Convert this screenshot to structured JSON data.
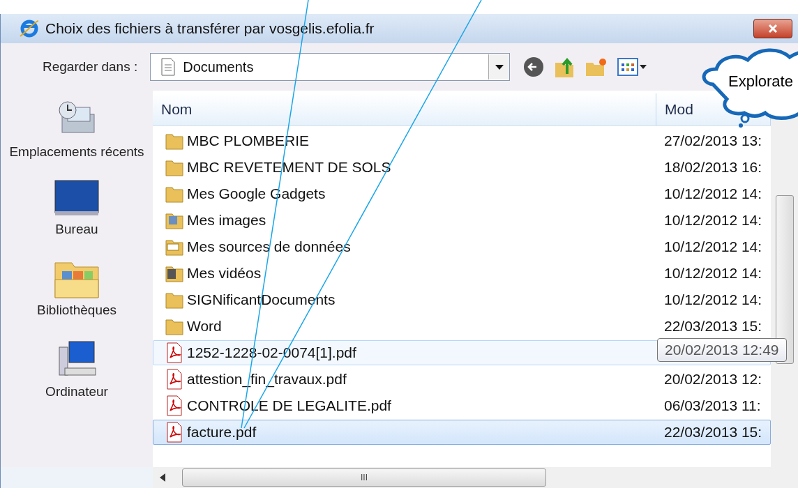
{
  "window": {
    "title": "Choix des fichiers à transférer par vosgelis.efolia.fr"
  },
  "toolbar": {
    "look_in_label": "Regarder dans :",
    "look_in_value": "Documents"
  },
  "sidebar": {
    "items": [
      {
        "label": "Emplacements récents",
        "kind": "recent"
      },
      {
        "label": "Bureau",
        "kind": "desktop"
      },
      {
        "label": "Bibliothèques",
        "kind": "libraries"
      },
      {
        "label": "Ordinateur",
        "kind": "computer"
      }
    ]
  },
  "table": {
    "columns": [
      "Nom",
      "Mod"
    ],
    "rows": [
      {
        "name": "MBC PLOMBERIE",
        "date": "27/02/2013 13:",
        "kind": "folder",
        "selected": false,
        "hovered": false
      },
      {
        "name": "MBC REVETEMENT DE SOLS",
        "date": "18/02/2013 16:",
        "kind": "folder",
        "selected": false,
        "hovered": false
      },
      {
        "name": "Mes Google Gadgets",
        "date": "10/12/2012 14:",
        "kind": "folder",
        "selected": false,
        "hovered": false
      },
      {
        "name": "Mes images",
        "date": "10/12/2012 14:",
        "kind": "pictures",
        "selected": false,
        "hovered": false
      },
      {
        "name": "Mes sources de données",
        "date": "10/12/2012 14:",
        "kind": "data",
        "selected": false,
        "hovered": false
      },
      {
        "name": "Mes vidéos",
        "date": "10/12/2012 14:",
        "kind": "videos",
        "selected": false,
        "hovered": false
      },
      {
        "name": "SIGNificantDocuments",
        "date": "10/12/2012 14:",
        "kind": "folder",
        "selected": false,
        "hovered": false
      },
      {
        "name": "Word",
        "date": "22/03/2013 15:",
        "kind": "folder",
        "selected": false,
        "hovered": false
      },
      {
        "name": "1252-1228-02-0074[1].pdf",
        "tooltip": "20/02/2013 12:49",
        "kind": "pdf",
        "selected": false,
        "hovered": true
      },
      {
        "name": "attestion_fin_travaux.pdf",
        "date": "20/02/2013 12:",
        "kind": "pdf",
        "selected": false,
        "hovered": false
      },
      {
        "name": "CONTROLE DE LEGALITE.pdf",
        "date": "06/03/2013 11:",
        "kind": "pdf",
        "selected": false,
        "hovered": false
      },
      {
        "name": "facture.pdf",
        "date": "22/03/2013 15:",
        "kind": "pdf",
        "selected": true,
        "hovered": false
      }
    ]
  },
  "callout": {
    "text": "Explorate"
  },
  "horizontal_scrollbar": {
    "thumb": "III"
  }
}
